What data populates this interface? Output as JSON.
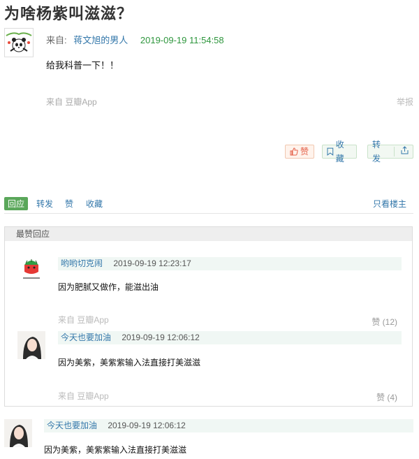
{
  "post": {
    "title": "为啥杨紫叫滋滋？",
    "from_label": "来自:",
    "author": "蒋文旭的男人",
    "time": "2019-09-19 11:54:58",
    "content": "给我科普一下！！",
    "from_app": "来自 豆瓣App",
    "report": "举报"
  },
  "actions": {
    "like": "赞",
    "collect": "收藏",
    "share": "转发"
  },
  "tabs": {
    "items": [
      "回应",
      "转发",
      "赞",
      "收藏"
    ],
    "only_op": "只看楼主"
  },
  "best": {
    "header": "最赞回应",
    "replies": [
      {
        "user": "哟哟切克闹",
        "time": "2019-09-19 12:23:17",
        "text": "因为肥腻又做作，能滋出油",
        "from_app": "来自 豆瓣App",
        "likes": "赞 (12)"
      },
      {
        "user": "今天也要加油",
        "time": "2019-09-19 12:06:12",
        "text": "因为美紫，美紫紫输入法直接打美滋滋",
        "from_app": "来自 豆瓣App",
        "likes": "赞 (4)"
      }
    ]
  },
  "replies": [
    {
      "user": "今天也要加油",
      "time": "2019-09-19 12:06:12",
      "text": "因为美紫，美紫紫输入法直接打美滋滋"
    }
  ]
}
